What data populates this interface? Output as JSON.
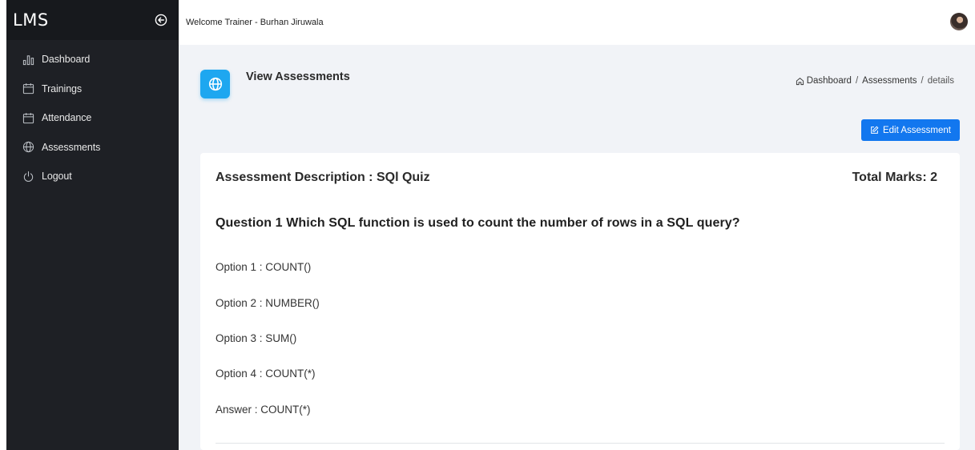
{
  "sidebar": {
    "brand": "LMS",
    "items": [
      {
        "label": "Dashboard",
        "icon": "bar-chart-icon"
      },
      {
        "label": "Trainings",
        "icon": "calendar-icon"
      },
      {
        "label": "Attendance",
        "icon": "calendar-icon"
      },
      {
        "label": "Assessments",
        "icon": "globe-icon"
      },
      {
        "label": "Logout",
        "icon": "power-icon"
      }
    ]
  },
  "topbar": {
    "welcome": "Welcome Trainer - Burhan Jiruwala"
  },
  "page": {
    "title": "View Assessments",
    "breadcrumb": {
      "home": "Dashboard",
      "section": "Assessments",
      "current": "details",
      "separator": "/"
    },
    "edit_button": "Edit Assessment"
  },
  "assessment": {
    "description": "Assessment Description : SQl Quiz",
    "total_marks": "Total Marks: 2",
    "question": "Question 1 Which SQL function is used to count the number of rows in a SQL query?",
    "options": [
      "Option 1 : COUNT()",
      "Option 2 : NUMBER()",
      "Option 3 : SUM()",
      "Option 4 : COUNT(*)"
    ],
    "answer": "Answer : COUNT(*)"
  },
  "colors": {
    "sidebar_bg": "#1e2025",
    "accent": "#1ea7f0",
    "button": "#1277ef",
    "content_bg": "#f1f3f7"
  }
}
